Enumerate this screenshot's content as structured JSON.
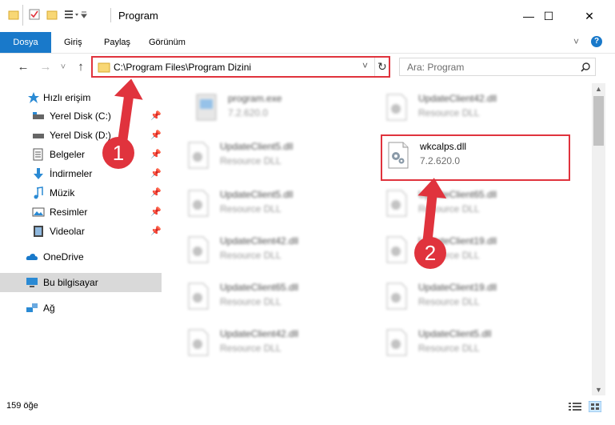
{
  "window": {
    "title": "Program",
    "minimize": "—",
    "maximize": "☐",
    "close": "✕"
  },
  "ribbon": {
    "tabs": [
      "Dosya",
      "Giriş",
      "Paylaş",
      "Görünüm"
    ]
  },
  "nav": {
    "back": "←",
    "forward": "→",
    "recent": "˅",
    "up": "↑"
  },
  "address": {
    "path": "C:\\Program Files\\Program Dizini",
    "dropdown": "˅",
    "refresh": "↻"
  },
  "search": {
    "placeholder": "Ara: Program",
    "icon": "search-icon"
  },
  "sidebar": {
    "items": [
      {
        "label": "Hızlı erişim",
        "icon": "star-icon"
      },
      {
        "label": "Yerel Disk (C:)",
        "icon": "drive-icon"
      },
      {
        "label": "Yerel Disk (D:)",
        "icon": "drive-icon"
      },
      {
        "label": "Belgeler",
        "icon": "documents-icon"
      },
      {
        "label": "İndirmeler",
        "icon": "download-icon"
      },
      {
        "label": "Müzik",
        "icon": "music-icon"
      },
      {
        "label": "Resimler",
        "icon": "pictures-icon"
      },
      {
        "label": "Videolar",
        "icon": "video-icon"
      },
      {
        "label": "OneDrive",
        "icon": "cloud-icon"
      },
      {
        "label": "Bu bilgisayar",
        "icon": "computer-icon"
      },
      {
        "label": "Ağ",
        "icon": "network-icon"
      }
    ]
  },
  "files": [
    {
      "name": "program.exe",
      "desc": "7.2.620.0"
    },
    {
      "name": "UpdateClient42.dll",
      "desc": "Resource DLL"
    },
    {
      "name": "UpdateClient5.dll",
      "desc": "Resource DLL"
    },
    {
      "name": "wkcalps.dll",
      "desc": "7.2.620.0"
    },
    {
      "name": "UpdateClient5.dll",
      "desc": "Resource DLL"
    },
    {
      "name": "UpdateClient65.dll",
      "desc": "Resource DLL"
    },
    {
      "name": "UpdateClient42.dll",
      "desc": "Resource DLL"
    },
    {
      "name": "UpdateClient19.dll",
      "desc": "Resource DLL"
    },
    {
      "name": "UpdateClient65.dll",
      "desc": "Resource DLL"
    },
    {
      "name": "UpdateClient19.dll",
      "desc": "Resource DLL"
    },
    {
      "name": "UpdateClient42.dll",
      "desc": "Resource DLL"
    },
    {
      "name": "UpdateClient5.dll",
      "desc": "Resource DLL"
    }
  ],
  "status": {
    "count": "159 öğe"
  },
  "annotations": {
    "step1": "1",
    "step2": "2"
  },
  "colors": {
    "accent": "#1979ca",
    "annotation": "#e0333d",
    "selected": "#d9d9d9"
  }
}
